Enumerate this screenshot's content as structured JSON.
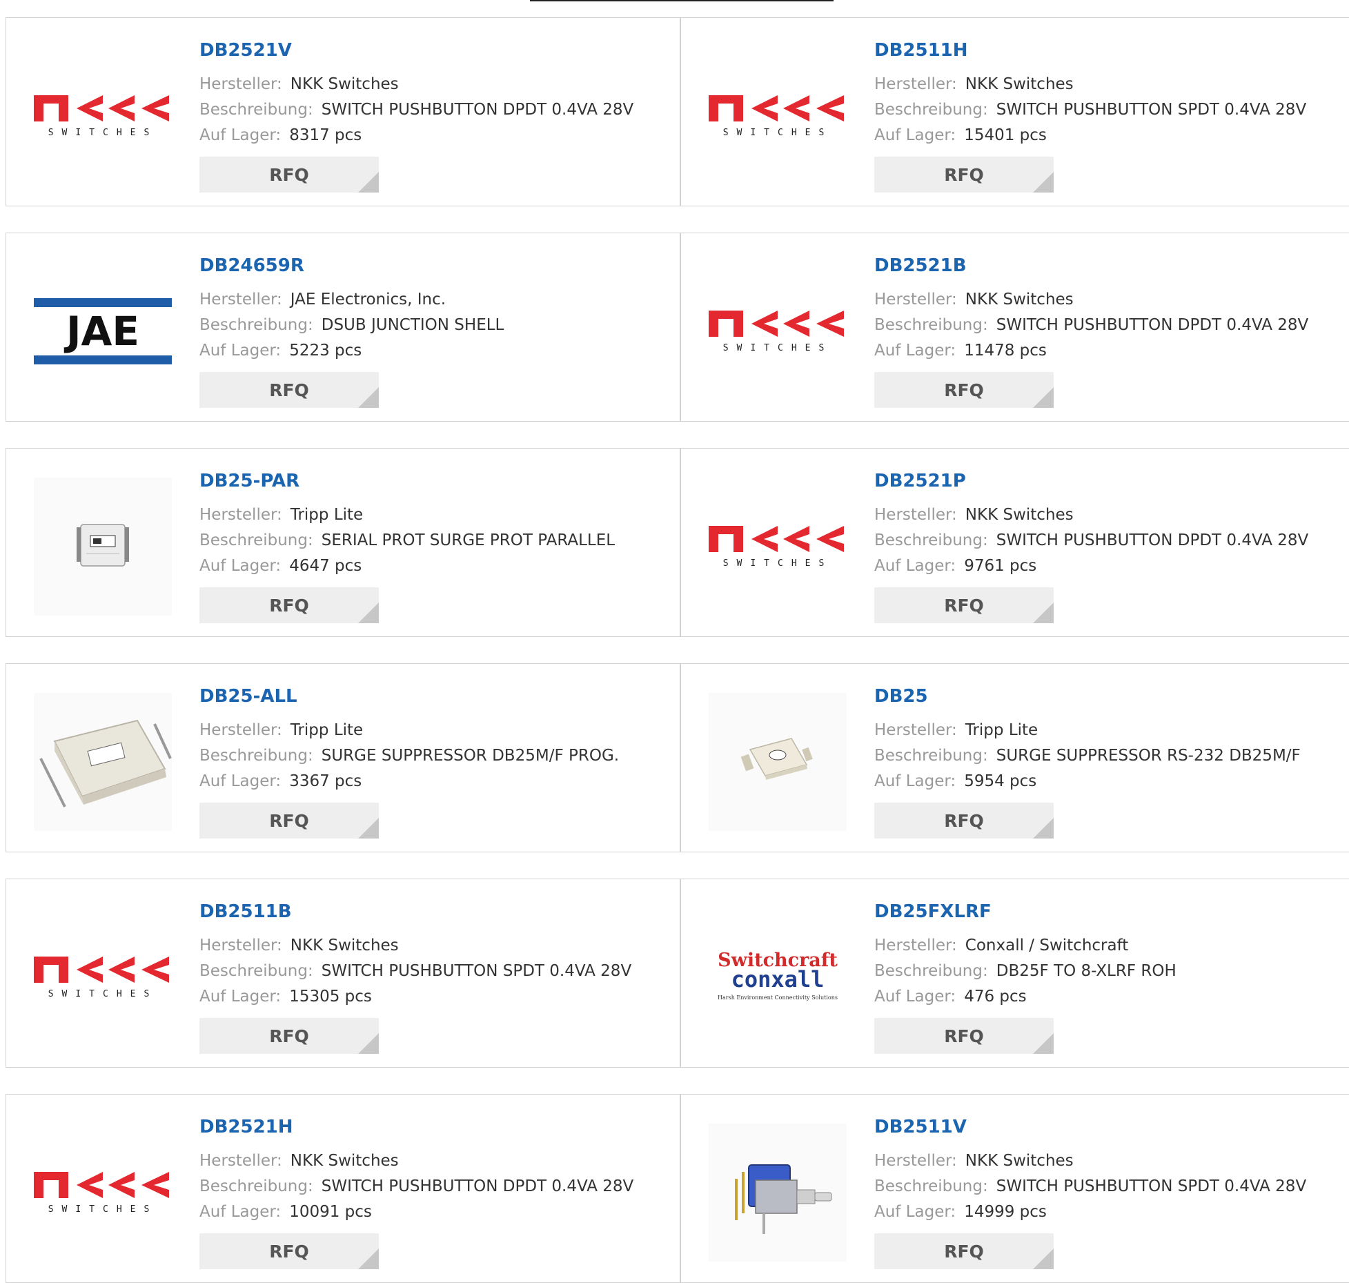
{
  "labels": {
    "manufacturer": "Hersteller:",
    "description": "Beschreibung:",
    "stock": "Auf Lager:",
    "rfq": "RFQ"
  },
  "products": [
    {
      "part": "DB2521V",
      "manufacturer": "NKK Switches",
      "description": "SWITCH PUSHBUTTON DPDT 0.4VA 28V",
      "stock": "8317 pcs",
      "logo": "nkk-logo"
    },
    {
      "part": "DB2511H",
      "manufacturer": "NKK Switches",
      "description": "SWITCH PUSHBUTTON SPDT 0.4VA 28V",
      "stock": "15401 pcs",
      "logo": "nkk-logo"
    },
    {
      "part": "DB24659R",
      "manufacturer": "JAE Electronics, Inc.",
      "description": "DSUB JUNCTION SHELL",
      "stock": "5223 pcs",
      "logo": "jae-logo"
    },
    {
      "part": "DB2521B",
      "manufacturer": "NKK Switches",
      "description": "SWITCH PUSHBUTTON DPDT 0.4VA 28V",
      "stock": "11478 pcs",
      "logo": "nkk-logo"
    },
    {
      "part": "DB25-PAR",
      "manufacturer": "Tripp Lite",
      "description": "SERIAL PROT SURGE PROT PARALLEL",
      "stock": "4647 pcs",
      "logo": "surge-protector-small-image"
    },
    {
      "part": "DB2521P",
      "manufacturer": "NKK Switches",
      "description": "SWITCH PUSHBUTTON DPDT 0.4VA 28V",
      "stock": "9761 pcs",
      "logo": "nkk-logo"
    },
    {
      "part": "DB25-ALL",
      "manufacturer": "Tripp Lite",
      "description": "SURGE SUPPRESSOR DB25M/F PROG.",
      "stock": "3367 pcs",
      "logo": "surge-suppressor-large-image"
    },
    {
      "part": "DB25",
      "manufacturer": "Tripp Lite",
      "description": "SURGE SUPPRESSOR RS-232 DB25M/F",
      "stock": "5954 pcs",
      "logo": "surge-suppressor-small-image"
    },
    {
      "part": "DB2511B",
      "manufacturer": "NKK Switches",
      "description": "SWITCH PUSHBUTTON SPDT 0.4VA 28V",
      "stock": "15305 pcs",
      "logo": "nkk-logo"
    },
    {
      "part": "DB25FXLRF",
      "manufacturer": "Conxall / Switchcraft",
      "description": "DB25F TO 8-XLRF ROH",
      "stock": "476 pcs",
      "logo": "switchcraft-conxall-logo",
      "logo_text": {
        "top": "Switchcraft",
        "bottom": "conxall",
        "tagline": "Harsh Environment Connectivity Solutions"
      }
    },
    {
      "part": "DB2521H",
      "manufacturer": "NKK Switches",
      "description": "SWITCH PUSHBUTTON DPDT 0.4VA 28V",
      "stock": "10091 pcs",
      "logo": "nkk-logo"
    },
    {
      "part": "DB2511V",
      "manufacturer": "NKK Switches",
      "description": "SWITCH PUSHBUTTON SPDT 0.4VA 28V",
      "stock": "14999 pcs",
      "logo": "pushbutton-switch-image"
    }
  ],
  "colors": {
    "title": "#1a64b0",
    "label": "#999999",
    "value": "#333333",
    "button_bg": "#eeeeee",
    "nkk_red": "#e4282f",
    "jae_blue": "#1f5da8"
  },
  "jae_text": "JAE",
  "nkk_sub": "SWITCHES"
}
